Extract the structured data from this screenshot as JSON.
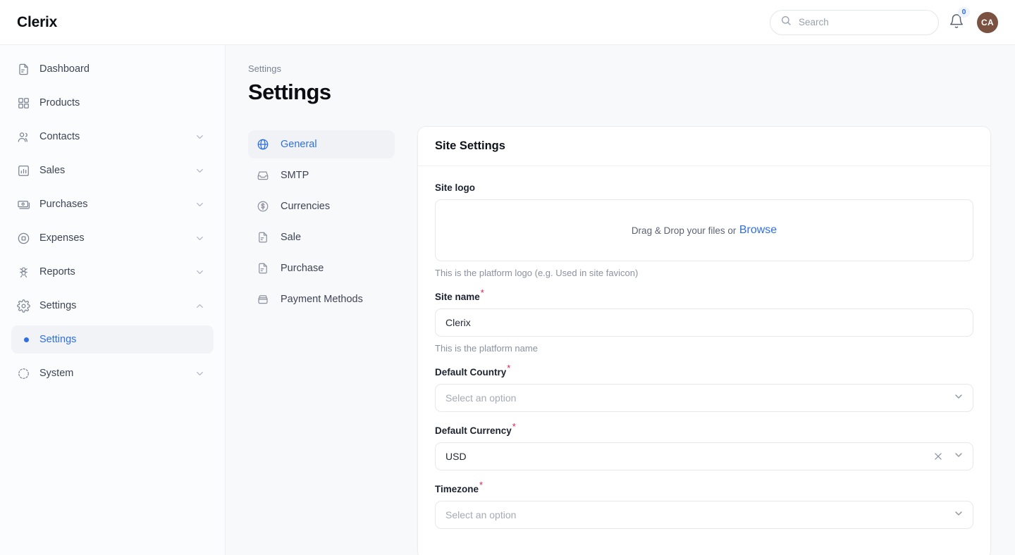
{
  "header": {
    "brand": "Clerix",
    "search_placeholder": "Search",
    "notification_count": "0",
    "avatar_initials": "CA"
  },
  "sidebar": {
    "items": [
      {
        "label": "Dashboard",
        "icon": "document-icon",
        "expandable": false
      },
      {
        "label": "Products",
        "icon": "grid-icon",
        "expandable": false
      },
      {
        "label": "Contacts",
        "icon": "users-icon",
        "expandable": true
      },
      {
        "label": "Sales",
        "icon": "bar-chart-icon",
        "expandable": true
      },
      {
        "label": "Purchases",
        "icon": "banknote-icon",
        "expandable": true
      },
      {
        "label": "Expenses",
        "icon": "circle-dot-icon",
        "expandable": true
      },
      {
        "label": "Reports",
        "icon": "flask-icon",
        "expandable": true
      },
      {
        "label": "Settings",
        "icon": "gear-icon",
        "expandable": true,
        "expanded": true
      },
      {
        "label": "System",
        "icon": "system-icon",
        "expandable": true
      }
    ],
    "active_sub_item": "Settings"
  },
  "main": {
    "breadcrumb": "Settings",
    "title": "Settings",
    "tabs": [
      {
        "label": "General",
        "icon": "globe-icon",
        "active": true
      },
      {
        "label": "SMTP",
        "icon": "inbox-icon",
        "active": false
      },
      {
        "label": "Currencies",
        "icon": "dollar-circle-icon",
        "active": false
      },
      {
        "label": "Sale",
        "icon": "document-icon",
        "active": false
      },
      {
        "label": "Purchase",
        "icon": "document-icon",
        "active": false
      },
      {
        "label": "Payment Methods",
        "icon": "wallet-icon",
        "active": false
      }
    ],
    "card": {
      "title": "Site Settings",
      "site_logo": {
        "label": "Site logo",
        "dropzone_text": "Drag & Drop your files or",
        "dropzone_link": "Browse",
        "helper": "This is the platform logo (e.g. Used in site favicon)"
      },
      "site_name": {
        "label": "Site name",
        "required": "*",
        "value": "Clerix",
        "helper": "This is the platform name"
      },
      "default_country": {
        "label": "Default Country",
        "required": "*",
        "placeholder": "Select an option"
      },
      "default_currency": {
        "label": "Default Currency",
        "required": "*",
        "value": "USD"
      },
      "timezone": {
        "label": "Timezone",
        "required": "*",
        "placeholder": "Select an option"
      }
    }
  },
  "colors": {
    "accent": "#2f6fe4",
    "required": "#e11d48",
    "avatar_bg": "#7b5242",
    "page_bg": "#f8f9fb"
  }
}
